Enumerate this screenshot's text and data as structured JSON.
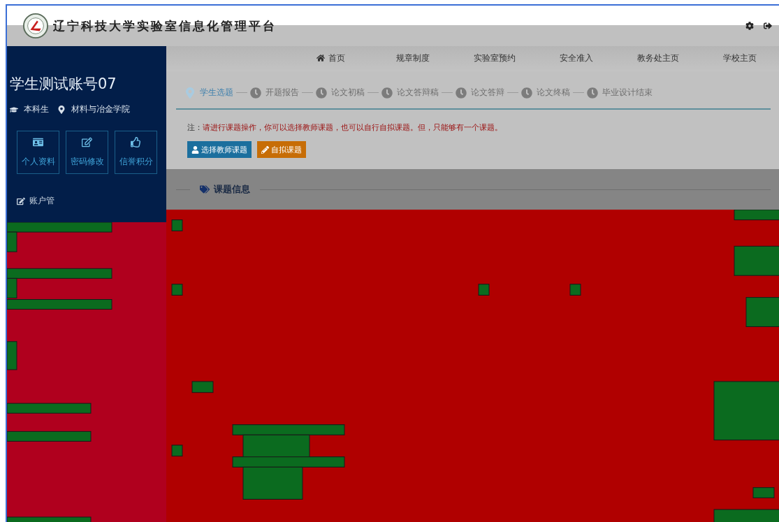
{
  "header": {
    "title": "辽宁科技大学实验室信息化管理平台"
  },
  "sidebar": {
    "user_name": "学生测试账号07",
    "degree": "本科生",
    "college": "材料与冶金学院",
    "tiles": [
      {
        "label": "个人资料",
        "kind": "profile"
      },
      {
        "label": "密码修改",
        "kind": "edit"
      },
      {
        "label": "信誉积分",
        "kind": "like"
      }
    ],
    "menu_items": [
      {
        "label": "账户管"
      }
    ]
  },
  "nav": {
    "items": [
      {
        "label": "首页",
        "kind": "home"
      },
      {
        "label": "规章制度",
        "kind": "link"
      },
      {
        "label": "实验室预约",
        "kind": "link"
      },
      {
        "label": "安全准入",
        "kind": "link"
      },
      {
        "label": "教务处主页",
        "kind": "link"
      },
      {
        "label": "学校主页",
        "kind": "link"
      }
    ]
  },
  "steps": [
    {
      "label": "学生选题",
      "selected": true
    },
    {
      "label": "开题报告",
      "selected": false
    },
    {
      "label": "论文初稿",
      "selected": false
    },
    {
      "label": "论文答辩稿",
      "selected": false
    },
    {
      "label": "论文答辩",
      "selected": false
    },
    {
      "label": "论文终稿",
      "selected": false
    },
    {
      "label": "毕业设计结束",
      "selected": false
    }
  ],
  "notice": {
    "prefix": "注：",
    "message": "请进行课题操作，你可以选择教师课题，也可以自行自拟课题。但，只能够有一个课题。"
  },
  "actions": [
    {
      "label": "选择教师课题",
      "kind": "primary"
    },
    {
      "label": "自拟课题",
      "kind": "warning"
    }
  ],
  "section": {
    "title": "课题信息"
  }
}
